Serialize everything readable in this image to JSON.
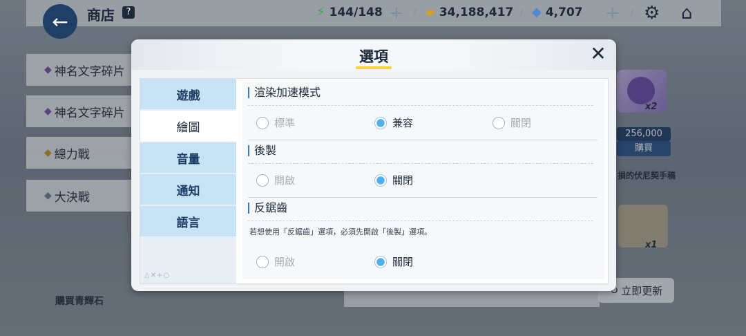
{
  "header": {
    "title": "商店",
    "help": "?",
    "ap": "144/148",
    "credits": "34,188,417",
    "gems": "4,707",
    "plus": "+",
    "sep": "/"
  },
  "background": {
    "left_items": [
      "神名文字碎片",
      "神名文字碎片",
      "總力戰",
      "大決戰"
    ],
    "buy_stone": "購買青輝石",
    "price": "256,000",
    "buy": "購買",
    "qty_top": "x2",
    "qty_bottom": "x1",
    "item_name": "損的伏尼契手稿",
    "update_btn": "立即更新"
  },
  "modal": {
    "title": "選項",
    "close": "✕",
    "tabs": [
      "遊戲",
      "繪圖",
      "音量",
      "通知",
      "語言"
    ],
    "active_tab": 1,
    "tab_foot": "△✕+○",
    "sections": [
      {
        "title": "渲染加速模式",
        "options": [
          "標準",
          "兼容",
          "關閉"
        ],
        "selected": 1
      },
      {
        "title": "後製",
        "options": [
          "開啟",
          "關閉"
        ],
        "selected": 1
      },
      {
        "title": "反鋸齒",
        "note": "若想使用「反鋸齒」選項，必須先開啟「後製」選項。",
        "options": [
          "開啟",
          "關閉"
        ],
        "selected": 1
      }
    ]
  },
  "colors": {
    "accent": "#4fb0ee",
    "tab": "#c8e2f6",
    "title_underline": "#f2d536",
    "navy": "#1c2a3b"
  }
}
